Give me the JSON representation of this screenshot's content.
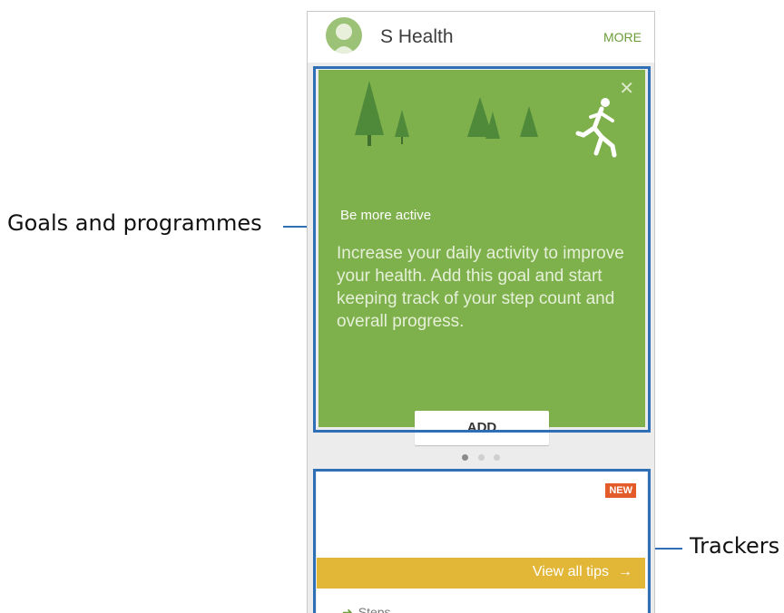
{
  "callouts": {
    "goals": "Goals and programmes",
    "trackers": "Trackers"
  },
  "app": {
    "title": "S Health",
    "more_label": "MORE"
  },
  "goal_card": {
    "kicker": "Be more active",
    "body": "Increase your daily activity to improve your health. Add this goal and start keeping track of your step count and overall progress.",
    "add_label": "ADD",
    "close_icon": "close-icon"
  },
  "pager": {
    "total": 3,
    "active": 1
  },
  "trackers": {
    "badge": "NEW",
    "tips_label": "View all tips",
    "steps_label": "Steps"
  },
  "colors": {
    "card_green": "#7eb04c",
    "highlight_blue": "#2e6fb6",
    "tips_yellow": "#e2b637",
    "badge_orange": "#e45b2a"
  }
}
